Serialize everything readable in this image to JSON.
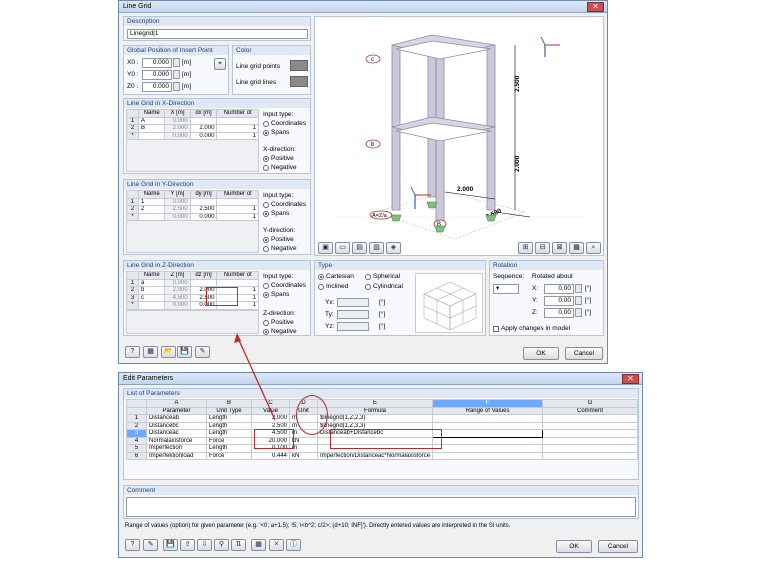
{
  "line_grid": {
    "title": "Line Grid",
    "description": {
      "header": "Description",
      "value": "Linegrid|1"
    },
    "insert_point": {
      "header": "Global Position of Insert Point",
      "rows": [
        {
          "label": "X0 :",
          "value": "0.000",
          "unit": "[m]"
        },
        {
          "label": "Y0 :",
          "value": "0.000",
          "unit": "[m]"
        },
        {
          "label": "Z0 :",
          "value": "0.000",
          "unit": "[m]"
        }
      ]
    },
    "color": {
      "header": "Color",
      "points_label": "Line grid points",
      "lines_label": "Line grid lines"
    },
    "x_dir": {
      "header": "Line Grid in X-Direction",
      "cols": [
        "Name",
        "X [m]",
        "dx [m]",
        "Number of"
      ],
      "rows": [
        [
          "1",
          "A",
          "0.000",
          "",
          ""
        ],
        [
          "2",
          "B",
          "2.000",
          "2.000",
          "1"
        ],
        [
          "*",
          "",
          "0.000",
          "0.000",
          "1"
        ]
      ],
      "input_type": "Input type:",
      "opt1": "Coordinates",
      "opt2": "Spans",
      "dir_label": "X-direction:",
      "pos": "Positive",
      "neg": "Negative"
    },
    "y_dir": {
      "header": "Line Grid in Y-Direction",
      "cols": [
        "Name",
        "Y [m]",
        "dy [m]",
        "Number of"
      ],
      "rows": [
        [
          "1",
          "1",
          "0.000",
          "",
          ""
        ],
        [
          "2",
          "2",
          "2.500",
          "2.500",
          "1"
        ],
        [
          "*",
          "",
          "0.000",
          "0.000",
          "1"
        ]
      ],
      "input_type": "Input type:",
      "opt1": "Coordinates",
      "opt2": "Spans",
      "dir_label": "Y-direction:",
      "pos": "Positive",
      "neg": "Negative"
    },
    "z_dir": {
      "header": "Line Grid in Z-Direction",
      "cols": [
        "Name",
        "Z [m]",
        "dz [m]",
        "Number of"
      ],
      "rows": [
        [
          "1",
          "a",
          "0.000",
          "",
          ""
        ],
        [
          "2",
          "b",
          "2.000",
          "2.000",
          "1"
        ],
        [
          "3",
          "c",
          "4.500",
          "2.500",
          "1"
        ],
        [
          "*",
          "",
          "0.000",
          "0.000",
          "1"
        ]
      ],
      "input_type": "Input type:",
      "opt1": "Coordinates",
      "opt2": "Spans",
      "dir_label": "Z-direction:",
      "pos": "Positive",
      "neg": "Negative"
    },
    "view": {
      "dim_h1": "2.500",
      "dim_h2": "2.000",
      "dim_w": "2.000",
      "dim_d": "2.500",
      "lbl_c": "c",
      "lbl_b": "b",
      "lbl_a": "A=Z/a",
      "lbl_B": "B"
    },
    "type": {
      "header": "Type",
      "cartesian": "Cartesian",
      "spherical": "Spherical",
      "inclined": "Inclined",
      "cylindrical": "Cylindrical",
      "yx": "Yx:",
      "ty": "Ty:",
      "yz": "Yz:",
      "unit": "[°]"
    },
    "rotation": {
      "header": "Rotation",
      "sequence": "Sequence:",
      "rotated_about": "Rotated about",
      "rows": [
        {
          "label": "X:",
          "value": "0.00",
          "unit": "[°]"
        },
        {
          "label": "Y:",
          "value": "0.00",
          "unit": "[°]"
        },
        {
          "label": "Z:",
          "value": "0.00",
          "unit": "[°]"
        }
      ],
      "apply": "Apply changes in model"
    },
    "ok": "OK",
    "cancel": "Cancel"
  },
  "edit_params": {
    "title": "Edit Parameters",
    "list_header": "List of Parameters",
    "col_letters": [
      "A",
      "B",
      "C",
      "D",
      "E",
      "F",
      "G"
    ],
    "col_names": [
      "Parameter",
      "Unit Type",
      "Value",
      "Unit",
      "Formula",
      "Range of Values",
      "Comment"
    ],
    "rows": [
      [
        "1",
        "Distanceab",
        "Length",
        "2.000",
        "m",
        "$linegrid(1,Z,2,3)",
        "",
        ""
      ],
      [
        "2",
        "Distancebc",
        "Length",
        "2.500",
        "m",
        "$linegrid(1,Z,3,3)",
        "",
        ""
      ],
      [
        "3",
        "Distanceac",
        "Length",
        "4.500",
        "m",
        "Distanceab+Distancebc",
        "",
        ""
      ],
      [
        "4",
        "Normalaxisforce",
        "Force",
        "20.000",
        "kN",
        "",
        "",
        ""
      ],
      [
        "5",
        "Imperfection",
        "Length",
        "0.100",
        "m",
        "",
        "",
        ""
      ],
      [
        "6",
        "Imperfektionload",
        "Force",
        "0.444",
        "kN",
        "Imperfection/Distanceac*Normalaxisforce",
        "",
        ""
      ]
    ],
    "comment_header": "Comment",
    "hint": "Range of values (option) for given parameter (e.g. '<0; a+1.5); !5; \\<b^2; c/2>; (d+10; INF]'). Directly entered values are interpreted in the SI units.",
    "ok": "OK",
    "cancel": "Cancel"
  },
  "colors": {
    "accent": "#c0282a",
    "frame": "#7f7f9f"
  }
}
